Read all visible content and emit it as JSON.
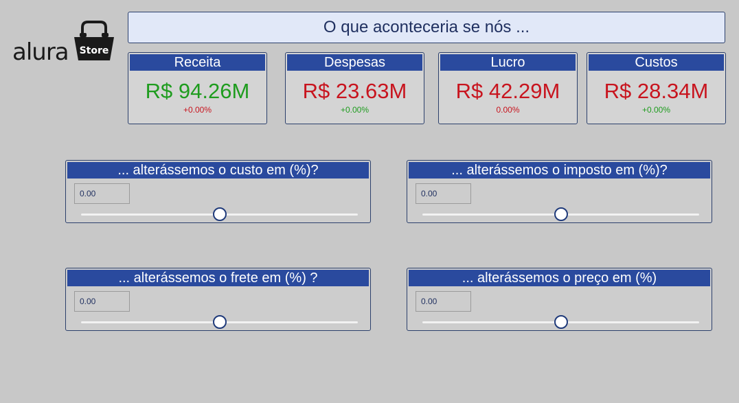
{
  "logo": {
    "brand": "alura",
    "badge": "Store"
  },
  "header": {
    "title": "O que aconteceria se nós ..."
  },
  "kpis": [
    {
      "label": "Receita",
      "value": "R$ 94.26M",
      "delta": "+0.00%",
      "value_color": "#1e9c1e",
      "delta_color": "#c8141e"
    },
    {
      "label": "Despesas",
      "value": "R$ 23.63M",
      "delta": "+0.00%",
      "value_color": "#c8141e",
      "delta_color": "#1e9c1e"
    },
    {
      "label": "Lucro",
      "value": "R$ 42.29M",
      "delta": "0.00%",
      "value_color": "#c8141e",
      "delta_color": "#c8141e"
    },
    {
      "label": "Custos",
      "value": "R$ 28.34M",
      "delta": "+0.00%",
      "value_color": "#c8141e",
      "delta_color": "#1e9c1e"
    }
  ],
  "sliders": [
    {
      "label": "... alterássemos o custo em (%)?",
      "value": "0.00",
      "position": 0.5
    },
    {
      "label": "... alterássemos o imposto em (%)?",
      "value": "0.00",
      "position": 0.5
    },
    {
      "label": "... alterássemos o frete em (%) ?",
      "value": "0.00",
      "position": 0.5
    },
    {
      "label": "... alterássemos o preço em (%)",
      "value": "0.00",
      "position": 0.5
    }
  ],
  "colors": {
    "background": "#c8c8c8",
    "header_bar": "#2a4a9e",
    "positive": "#1e9c1e",
    "negative": "#c8141e"
  }
}
